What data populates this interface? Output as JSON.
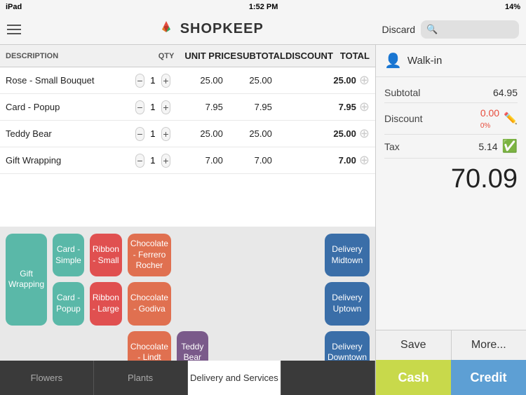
{
  "status_bar": {
    "left": "iPad",
    "time": "1:52 PM",
    "right": "14%"
  },
  "header": {
    "logo_text": "SHOPKEEP",
    "discard_label": "Discard",
    "search_placeholder": ""
  },
  "table": {
    "columns": [
      "DESCRIPTION",
      "QTY",
      "UNIT PRICE",
      "SUBTOTAL",
      "DISCOUNT",
      "TOTAL"
    ],
    "rows": [
      {
        "desc": "Rose - Small Bouquet",
        "qty": 1,
        "unit": "25.00",
        "sub": "25.00",
        "disc": "",
        "total": "25.00"
      },
      {
        "desc": "Card - Popup",
        "qty": 1,
        "unit": "7.95",
        "sub": "7.95",
        "disc": "",
        "total": "7.95"
      },
      {
        "desc": "Teddy Bear",
        "qty": 1,
        "unit": "25.00",
        "sub": "25.00",
        "disc": "",
        "total": "25.00"
      },
      {
        "desc": "Gift Wrapping",
        "qty": 1,
        "unit": "7.00",
        "sub": "7.00",
        "disc": "",
        "total": "7.00"
      }
    ]
  },
  "products": [
    {
      "label": "Gift Wrapping",
      "color": "#5ab8a8",
      "col": 1,
      "row": 1,
      "rowspan": 2
    },
    {
      "label": "Card - Simple",
      "color": "#5ab8a8",
      "col": 2,
      "row": 1
    },
    {
      "label": "Ribbon - Small",
      "color": "#e05050",
      "col": 3,
      "row": 1
    },
    {
      "label": "Chocolate - Ferrero Rocher",
      "color": "#e07050",
      "col": 4,
      "row": 1
    },
    {
      "label": "",
      "color": "",
      "col": 5,
      "row": 1
    },
    {
      "label": "",
      "color": "",
      "col": 6,
      "row": 1
    },
    {
      "label": "",
      "color": "",
      "col": 7,
      "row": 1
    },
    {
      "label": "Delivery Midtown",
      "color": "#3a6ea8",
      "col": 9,
      "row": 1
    },
    {
      "label": "Card - Popup",
      "color": "#5ab8a8",
      "col": 2,
      "row": 2
    },
    {
      "label": "Ribbon - Large",
      "color": "#e05050",
      "col": 3,
      "row": 2
    },
    {
      "label": "Chocolate - Godiva",
      "color": "#e07050",
      "col": 4,
      "row": 2
    },
    {
      "label": "Delivery Uptown",
      "color": "#3a6ea8",
      "col": 9,
      "row": 2
    },
    {
      "label": "Chocolate - Lindt",
      "color": "#e07050",
      "col": 4,
      "row": 3
    },
    {
      "label": "Teddy Bear",
      "color": "#7a5a8a",
      "col": 5,
      "row": 3
    },
    {
      "label": "Delivery Downtown",
      "color": "#3a6ea8",
      "col": 9,
      "row": 3
    }
  ],
  "tabs": [
    {
      "label": "Flowers",
      "active": false
    },
    {
      "label": "Plants",
      "active": false
    },
    {
      "label": "Delivery and Services",
      "active": true
    },
    {
      "label": "",
      "active": false
    }
  ],
  "right_panel": {
    "customer": "Walk-in",
    "subtotal_label": "Subtotal",
    "subtotal_value": "64.95",
    "discount_label": "Discount",
    "discount_value": "0.00",
    "discount_pct": "0%",
    "tax_label": "Tax",
    "tax_value": "5.14",
    "grand_total": "70.09",
    "save_label": "Save",
    "more_label": "More...",
    "cash_label": "Cash",
    "credit_label": "Credit"
  }
}
